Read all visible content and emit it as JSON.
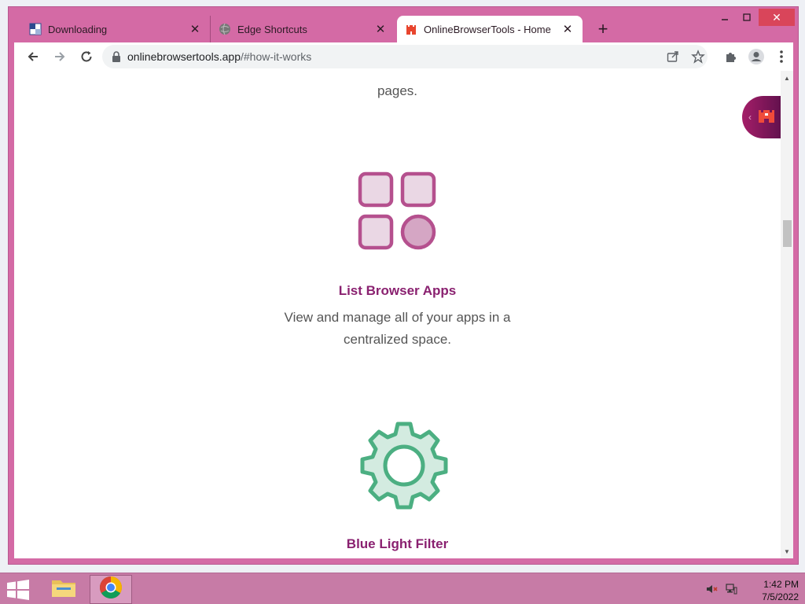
{
  "browser": {
    "tabs": [
      {
        "title": "Downloading",
        "icon": "document-check-icon"
      },
      {
        "title": "Edge Shortcuts",
        "icon": "globe-icon"
      },
      {
        "title": "OnlineBrowserTools - Home",
        "icon": "castle-icon",
        "active": true
      }
    ],
    "new_tab_label": "+",
    "url_host": "onlinebrowsertools.app",
    "url_path": "/#how-it-works"
  },
  "page": {
    "intro_tail": "pages.",
    "features": [
      {
        "title": "List Browser Apps",
        "description": "View and manage all of your apps in a centralized space.",
        "icon": "grid-apps-icon"
      },
      {
        "title": "Blue Light Filter",
        "icon": "gear-icon"
      }
    ]
  },
  "taskbar": {
    "time": "1:42 PM",
    "date": "7/5/2022"
  },
  "colors": {
    "window_frame": "#d46aa5",
    "accent_title": "#8a2170",
    "grid_icon_stroke": "#b5508e",
    "gear_stroke": "#4caf82"
  }
}
